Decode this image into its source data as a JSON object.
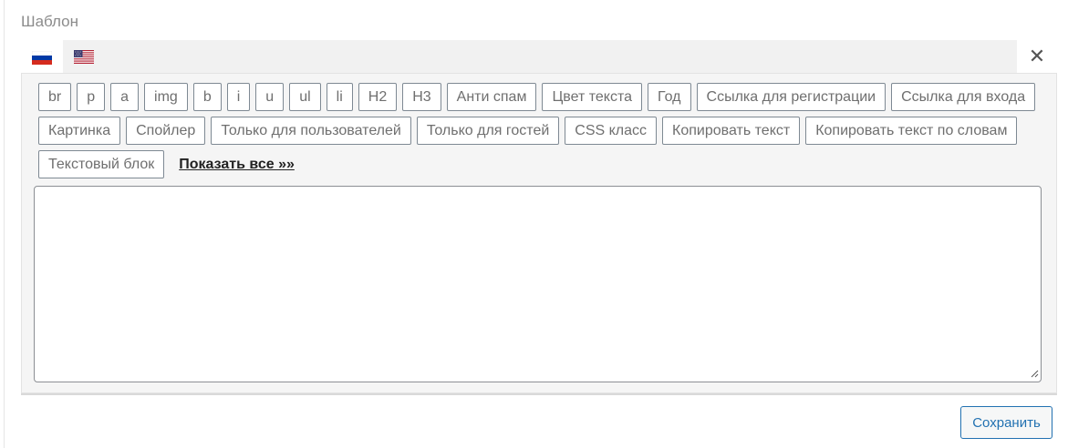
{
  "field": {
    "label": "Шаблон"
  },
  "tabs": [
    {
      "lang": "ru",
      "icon": "russia-flag-icon",
      "active": true
    },
    {
      "lang": "en",
      "icon": "usa-flag-icon",
      "active": false
    }
  ],
  "close": {
    "glyph": "✕"
  },
  "toolbar": {
    "rows": [
      [
        "br",
        "p",
        "a",
        "img",
        "b",
        "i",
        "u",
        "ul",
        "li",
        "H2",
        "H3",
        "Анти спам",
        "Цвет текста",
        "Год",
        "Ссылка для регистрации",
        "Ссылка для входа"
      ],
      [
        "Картинка",
        "Спойлер",
        "Только для пользователей",
        "Только для гостей",
        "CSS класс",
        "Копировать текст",
        "Копировать текст по словам"
      ],
      [
        "Текстовый блок"
      ]
    ],
    "show_all": "Показать все »»"
  },
  "textarea": {
    "value": ""
  },
  "save_label": "Сохранить",
  "colors": {
    "accent": "#2271b1",
    "button_border": "#7e8993",
    "editor_bg": "#f5f5f5"
  }
}
